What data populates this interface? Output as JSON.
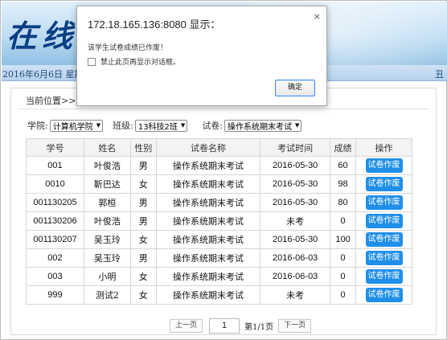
{
  "header": {
    "logo_text": "在线",
    "date_text": "2016年6月6日 星期",
    "right_text": "丑"
  },
  "breadcrumb": {
    "text": "当前位置>>试"
  },
  "filters": {
    "college_label": "学院:",
    "college_value": "计算机学院",
    "class_label": "班级:",
    "class_value": "13科技2班",
    "paper_label": "试卷:",
    "paper_value": "操作系统期末考试"
  },
  "table": {
    "headers": {
      "id": "学号",
      "name": "姓名",
      "gender": "性别",
      "paper": "试卷名称",
      "time": "考试时间",
      "score": "成绩",
      "action": "操作"
    },
    "rows": [
      {
        "id": "001",
        "name": "叶俊浩",
        "gender": "男",
        "paper": "操作系统期末考试",
        "time": "2016-05-30",
        "score": "60",
        "action": "试卷作废"
      },
      {
        "id": "0010",
        "name": "靳巴达",
        "gender": "女",
        "paper": "操作系统期末考试",
        "time": "2016-05-30",
        "score": "98",
        "action": "试卷作废"
      },
      {
        "id": "001130205",
        "name": "郭桓",
        "gender": "男",
        "paper": "操作系统期末考试",
        "time": "2016-05-30",
        "score": "80",
        "action": "试卷作废"
      },
      {
        "id": "001130206",
        "name": "叶俊浩",
        "gender": "男",
        "paper": "操作系统期末考试",
        "time": "未考",
        "score": "0",
        "action": "试卷作废"
      },
      {
        "id": "001130207",
        "name": "吴玉玲",
        "gender": "女",
        "paper": "操作系统期末考试",
        "time": "2016-05-30",
        "score": "100",
        "action": "试卷作废"
      },
      {
        "id": "002",
        "name": "吴玉玲",
        "gender": "男",
        "paper": "操作系统期末考试",
        "time": "2016-06-03",
        "score": "0",
        "action": "试卷作废"
      },
      {
        "id": "003",
        "name": "小明",
        "gender": "女",
        "paper": "操作系统期末考试",
        "time": "2016-06-03",
        "score": "0",
        "action": "试卷作废"
      },
      {
        "id": "999",
        "name": "测试2",
        "gender": "女",
        "paper": "操作系统期末考试",
        "time": "未考",
        "score": "0",
        "action": "试卷作废"
      }
    ]
  },
  "pager": {
    "prev": "上一页",
    "page_input": "1",
    "info": "第1/1页",
    "next": "下一页"
  },
  "dialog": {
    "title": "172.18.165.136:8080 显示：",
    "close": "×",
    "message": "该学生试卷成绩已作废！",
    "checkbox_label": "禁止此页再显示对话框。",
    "ok": "确定"
  }
}
